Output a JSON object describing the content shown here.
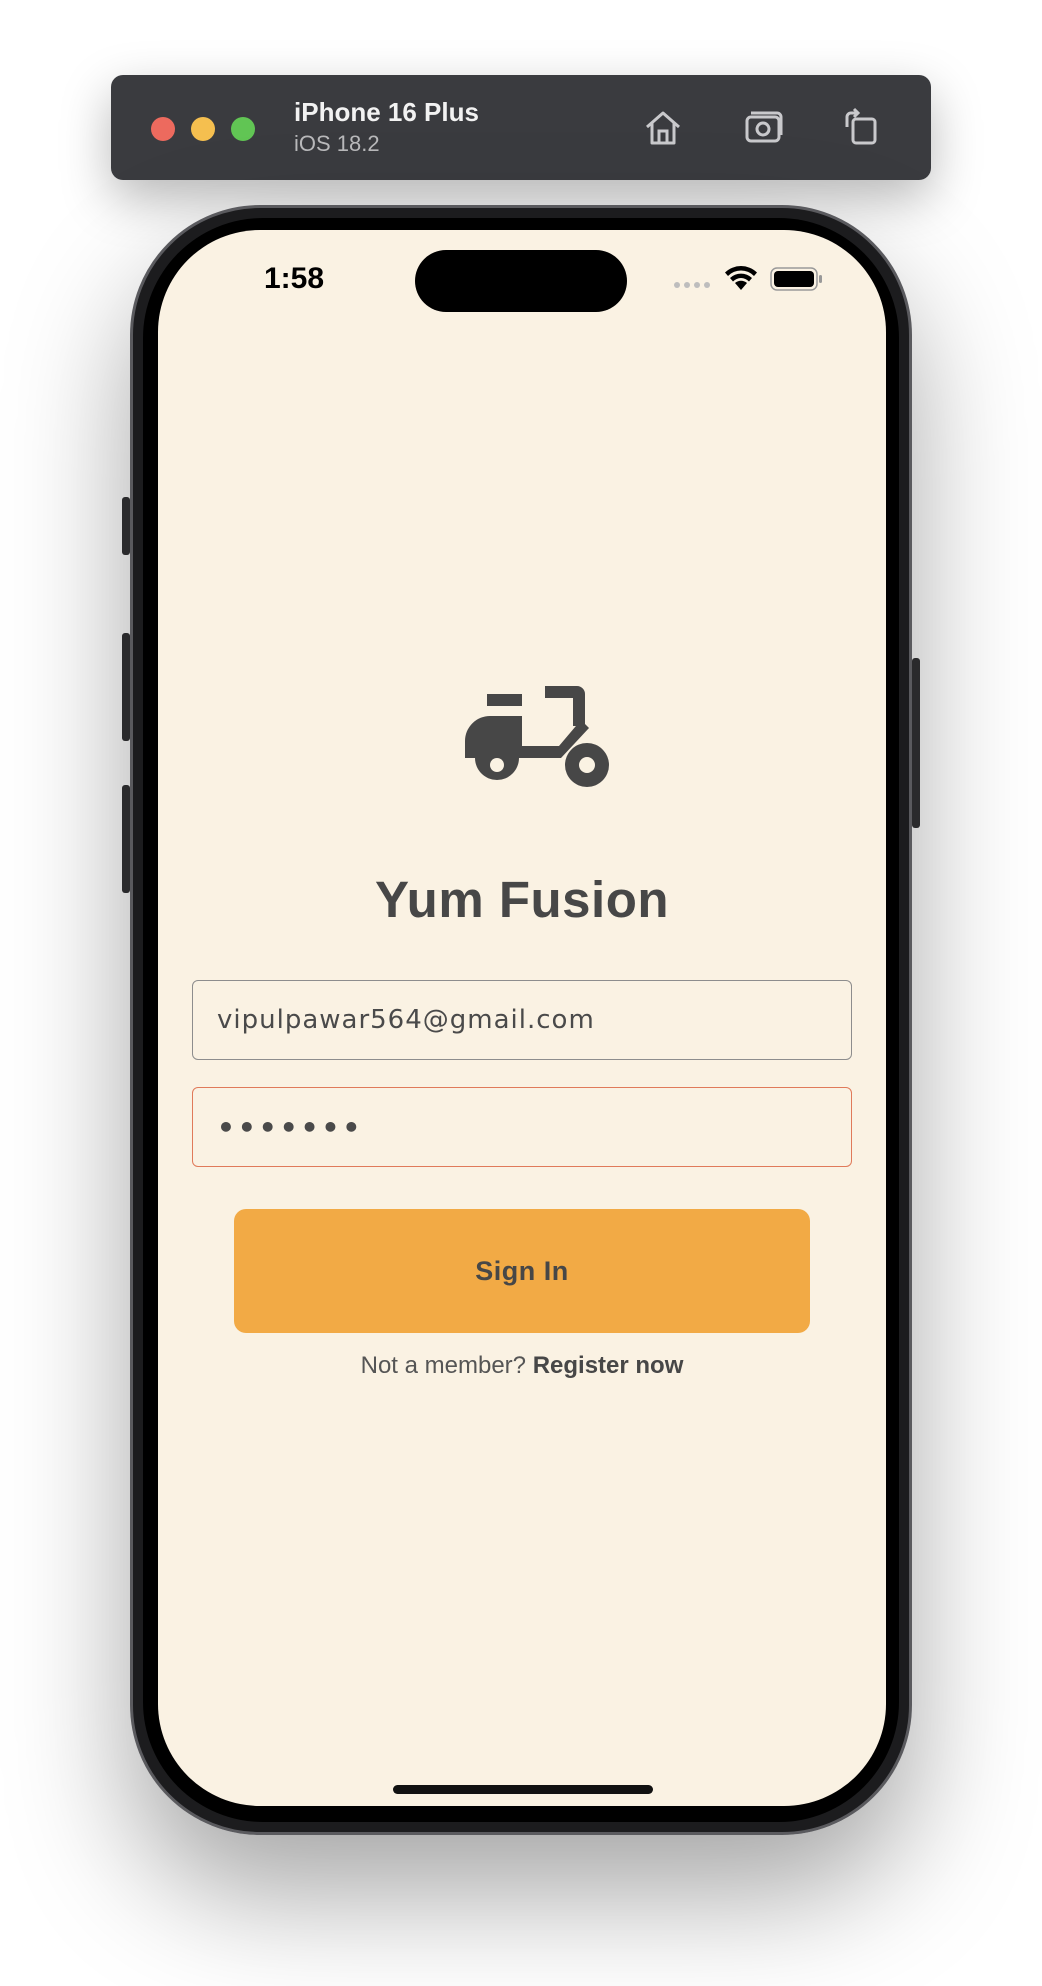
{
  "simulator": {
    "device_name": "iPhone 16 Plus",
    "os_version": "iOS 18.2",
    "toolbar_buttons": [
      {
        "name": "home",
        "icon": "home-icon"
      },
      {
        "name": "screenshot",
        "icon": "camera-icon"
      },
      {
        "name": "rotate",
        "icon": "rotate-icon"
      }
    ]
  },
  "status_bar": {
    "time": "1:58"
  },
  "app": {
    "logo_icon": "scooter-icon",
    "title": "Yum Fusion"
  },
  "login_form": {
    "email_value": "vipulpawar564@gmail.com",
    "password_masked": "•••••••",
    "sign_in_label": "Sign In",
    "register_prompt": "Not a member?",
    "register_link": "Register now"
  },
  "colors": {
    "screen_background": "#faf2e3",
    "accent_button": "#f2aa45",
    "password_border": "#e07a5a",
    "text_dark": "#474747"
  }
}
